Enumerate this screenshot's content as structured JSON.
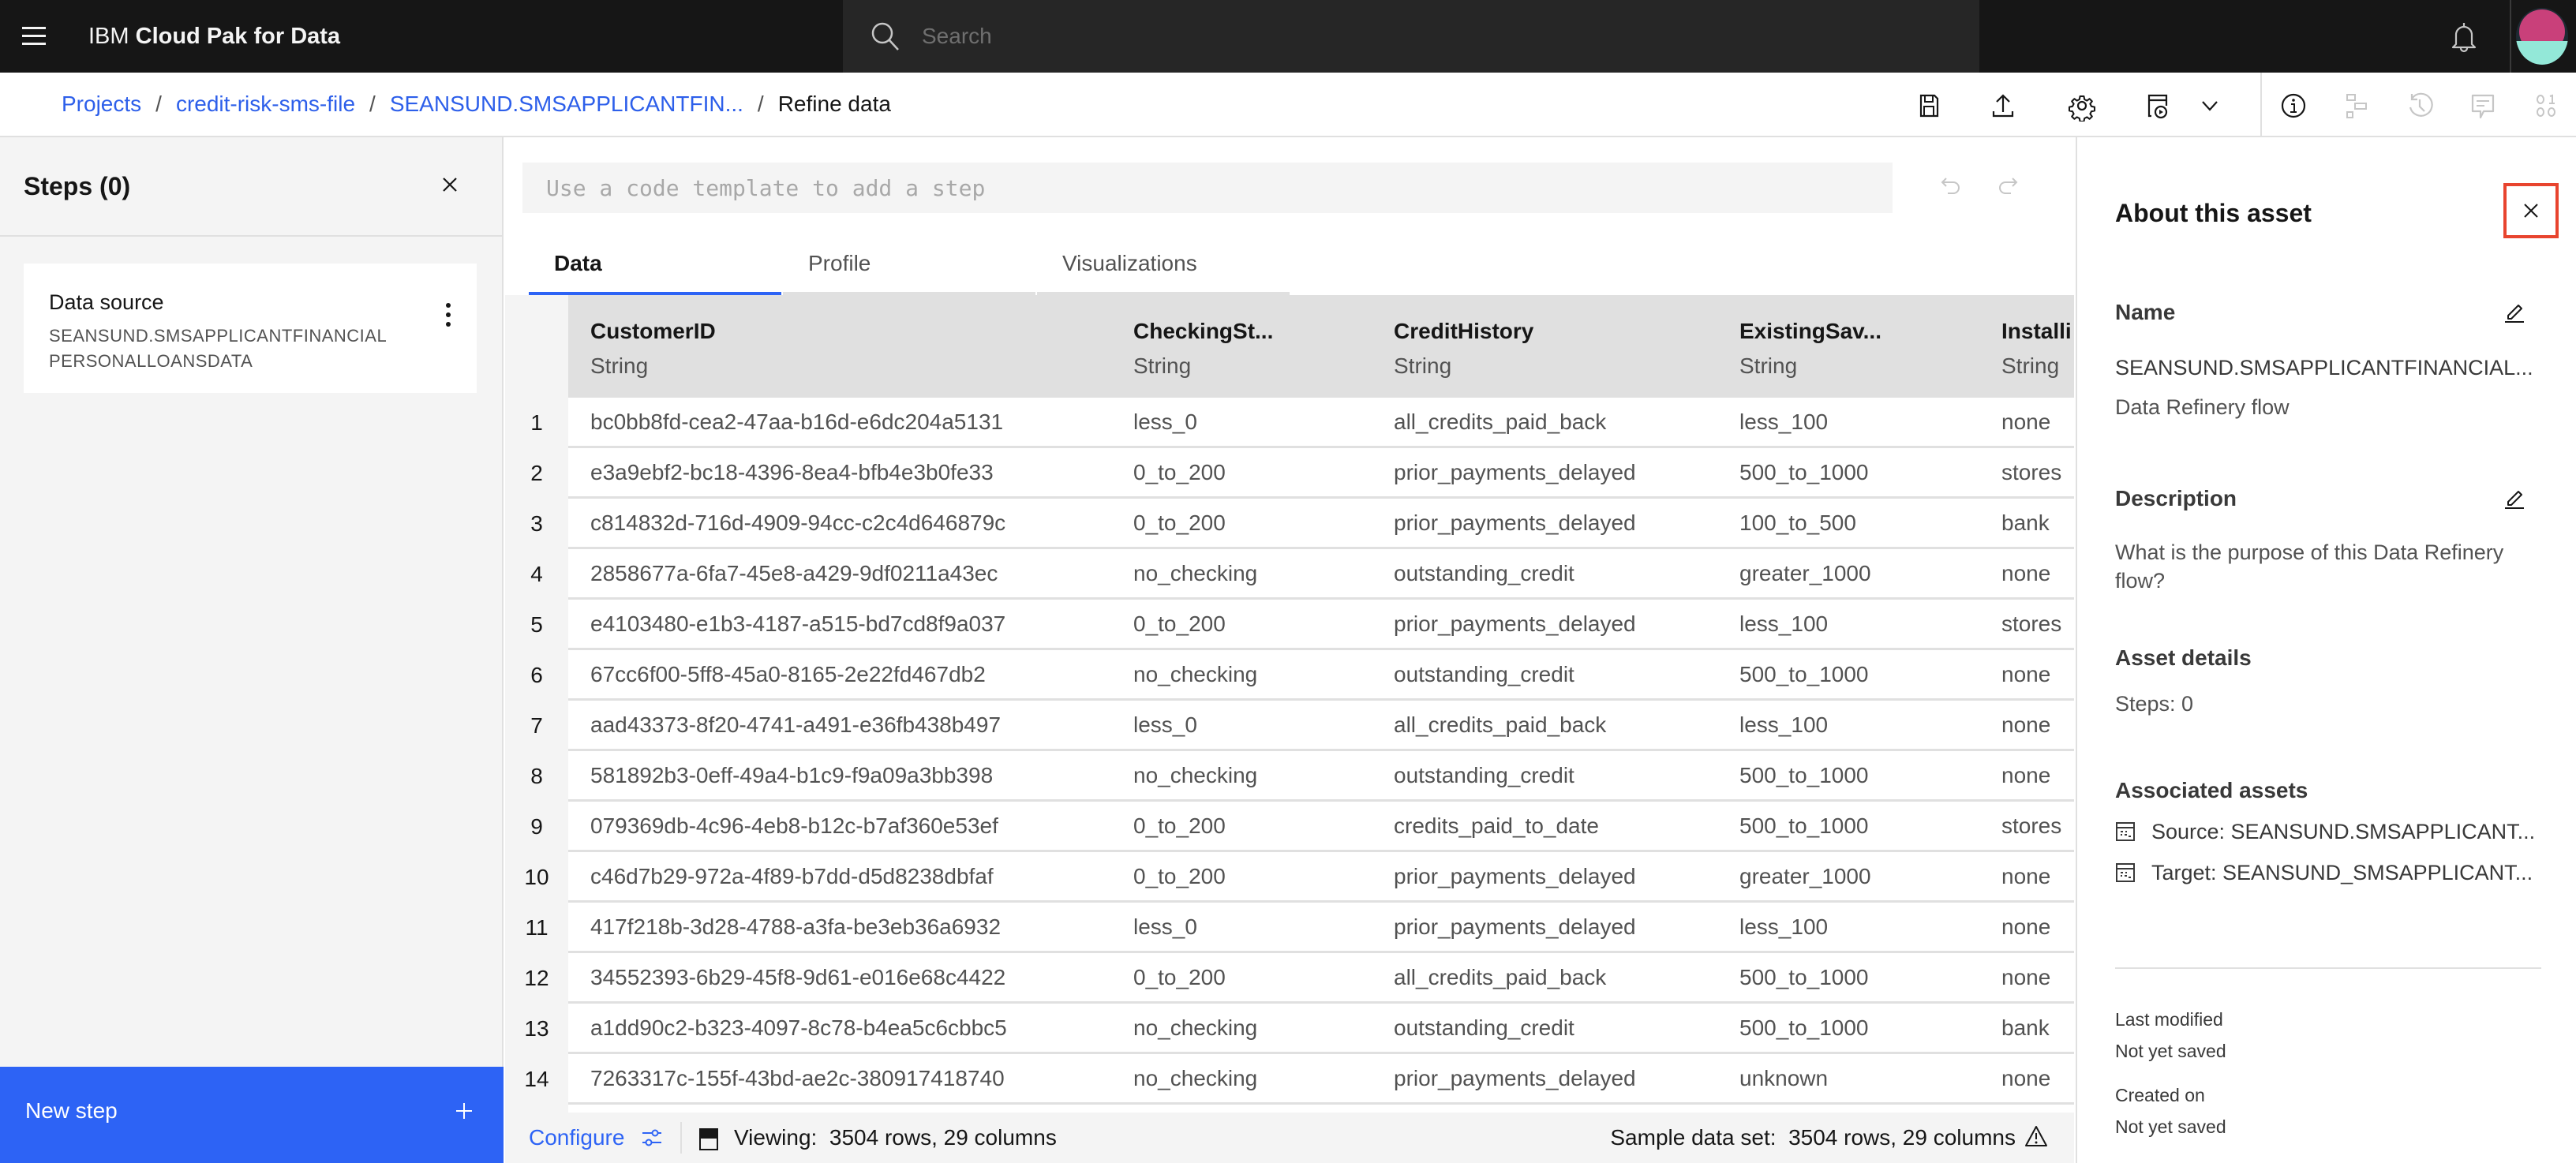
{
  "topnav": {
    "brand_prefix": "IBM",
    "brand_name": "Cloud Pak for Data",
    "search_placeholder": "Search"
  },
  "breadcrumb": {
    "items": [
      {
        "label": "Projects",
        "link": true
      },
      {
        "label": "credit-risk-sms-file",
        "link": true
      },
      {
        "label": "SEANSUND.SMSAPPLICANTFIN...",
        "link": true
      },
      {
        "label": "Refine data",
        "link": false
      }
    ],
    "separator": "/"
  },
  "toolbar": {
    "icons": [
      "save-icon",
      "export-icon",
      "settings-icon",
      "job-run-icon",
      "chevron-down-icon",
      "info-icon",
      "lineage-icon",
      "history-icon",
      "comment-icon",
      "binary-icon"
    ]
  },
  "steps_panel": {
    "title": "Steps (0)",
    "card": {
      "title": "Data source",
      "subtitle_line1": "SEANSUND.SMSAPPLICANTFINANCIAL",
      "subtitle_line2": "PERSONALLOANSDATA"
    },
    "new_step_label": "New step"
  },
  "code_input": {
    "placeholder": "Use a code template to add a step",
    "value": ""
  },
  "tabs": [
    {
      "label": "Data",
      "active": true
    },
    {
      "label": "Profile",
      "active": false
    },
    {
      "label": "Visualizations",
      "active": false
    }
  ],
  "table": {
    "columns": [
      {
        "name": "CustomerID",
        "type": "String"
      },
      {
        "name": "CheckingSt...",
        "type": "String"
      },
      {
        "name": "CreditHistory",
        "type": "String"
      },
      {
        "name": "ExistingSav...",
        "type": "String"
      },
      {
        "name": "Installi",
        "type": "String"
      }
    ],
    "rows": [
      {
        "n": "1",
        "cells": [
          "bc0bb8fd-cea2-47aa-b16d-e6dc204a5131",
          "less_0",
          "all_credits_paid_back",
          "less_100",
          "none"
        ]
      },
      {
        "n": "2",
        "cells": [
          "e3a9ebf2-bc18-4396-8ea4-bfb4e3b0fe33",
          "0_to_200",
          "prior_payments_delayed",
          "500_to_1000",
          "stores"
        ]
      },
      {
        "n": "3",
        "cells": [
          "c814832d-716d-4909-94cc-c2c4d646879c",
          "0_to_200",
          "prior_payments_delayed",
          "100_to_500",
          "bank"
        ]
      },
      {
        "n": "4",
        "cells": [
          "2858677a-6fa7-45e8-a429-9df0211a43ec",
          "no_checking",
          "outstanding_credit",
          "greater_1000",
          "none"
        ]
      },
      {
        "n": "5",
        "cells": [
          "e4103480-e1b3-4187-a515-bd7cd8f9a037",
          "0_to_200",
          "prior_payments_delayed",
          "less_100",
          "stores"
        ]
      },
      {
        "n": "6",
        "cells": [
          "67cc6f00-5ff8-45a0-8165-2e22fd467db2",
          "no_checking",
          "outstanding_credit",
          "500_to_1000",
          "none"
        ]
      },
      {
        "n": "7",
        "cells": [
          "aad43373-8f20-4741-a491-e36fb438b497",
          "less_0",
          "all_credits_paid_back",
          "less_100",
          "none"
        ]
      },
      {
        "n": "8",
        "cells": [
          "581892b3-0eff-49a4-b1c9-f9a09a3bb398",
          "no_checking",
          "outstanding_credit",
          "500_to_1000",
          "none"
        ]
      },
      {
        "n": "9",
        "cells": [
          "079369db-4c96-4eb8-b12c-b7af360e53ef",
          "0_to_200",
          "credits_paid_to_date",
          "500_to_1000",
          "stores"
        ]
      },
      {
        "n": "10",
        "cells": [
          "c46d7b29-972a-4f89-b7dd-d5d8238dbfaf",
          "0_to_200",
          "prior_payments_delayed",
          "greater_1000",
          "none"
        ]
      },
      {
        "n": "11",
        "cells": [
          "417f218b-3d28-4788-a3fa-be3eb36a6932",
          "less_0",
          "prior_payments_delayed",
          "less_100",
          "none"
        ]
      },
      {
        "n": "12",
        "cells": [
          "34552393-6b29-45f8-9d61-e016e68c4422",
          "0_to_200",
          "all_credits_paid_back",
          "500_to_1000",
          "none"
        ]
      },
      {
        "n": "13",
        "cells": [
          "a1dd90c2-b323-4097-8c78-b4ea5c6cbbc5",
          "no_checking",
          "outstanding_credit",
          "500_to_1000",
          "bank"
        ]
      },
      {
        "n": "14",
        "cells": [
          "7263317c-155f-43bd-ae2c-380917418740",
          "no_checking",
          "prior_payments_delayed",
          "unknown",
          "none"
        ]
      }
    ]
  },
  "footer": {
    "configure_label": "Configure",
    "viewing_label": "Viewing:",
    "viewing_value": "3504 rows, 29 columns",
    "sample_label": "Sample data set:",
    "sample_value": "3504 rows, 29 columns"
  },
  "about_panel": {
    "title": "About this asset",
    "name_label": "Name",
    "name_value": "SEANSUND.SMSAPPLICANTFINANCIAL...",
    "asset_type": "Data Refinery flow",
    "description_label": "Description",
    "description_value": "What is the purpose of this Data Refinery flow?",
    "details_label": "Asset details",
    "steps_value": "Steps: 0",
    "associated_label": "Associated assets",
    "source": "Source: SEANSUND.SMSAPPLICANT...",
    "target": "Target: SEANSUND_SMSAPPLICANT...",
    "last_modified_label": "Last modified",
    "last_modified_value": "Not yet saved",
    "created_label": "Created on",
    "created_value": "Not yet saved"
  },
  "colors": {
    "accent_blue": "#2d63f5",
    "link_blue": "#2d5fea",
    "highlight_red": "#e8442e",
    "nav_bg": "#161616"
  }
}
